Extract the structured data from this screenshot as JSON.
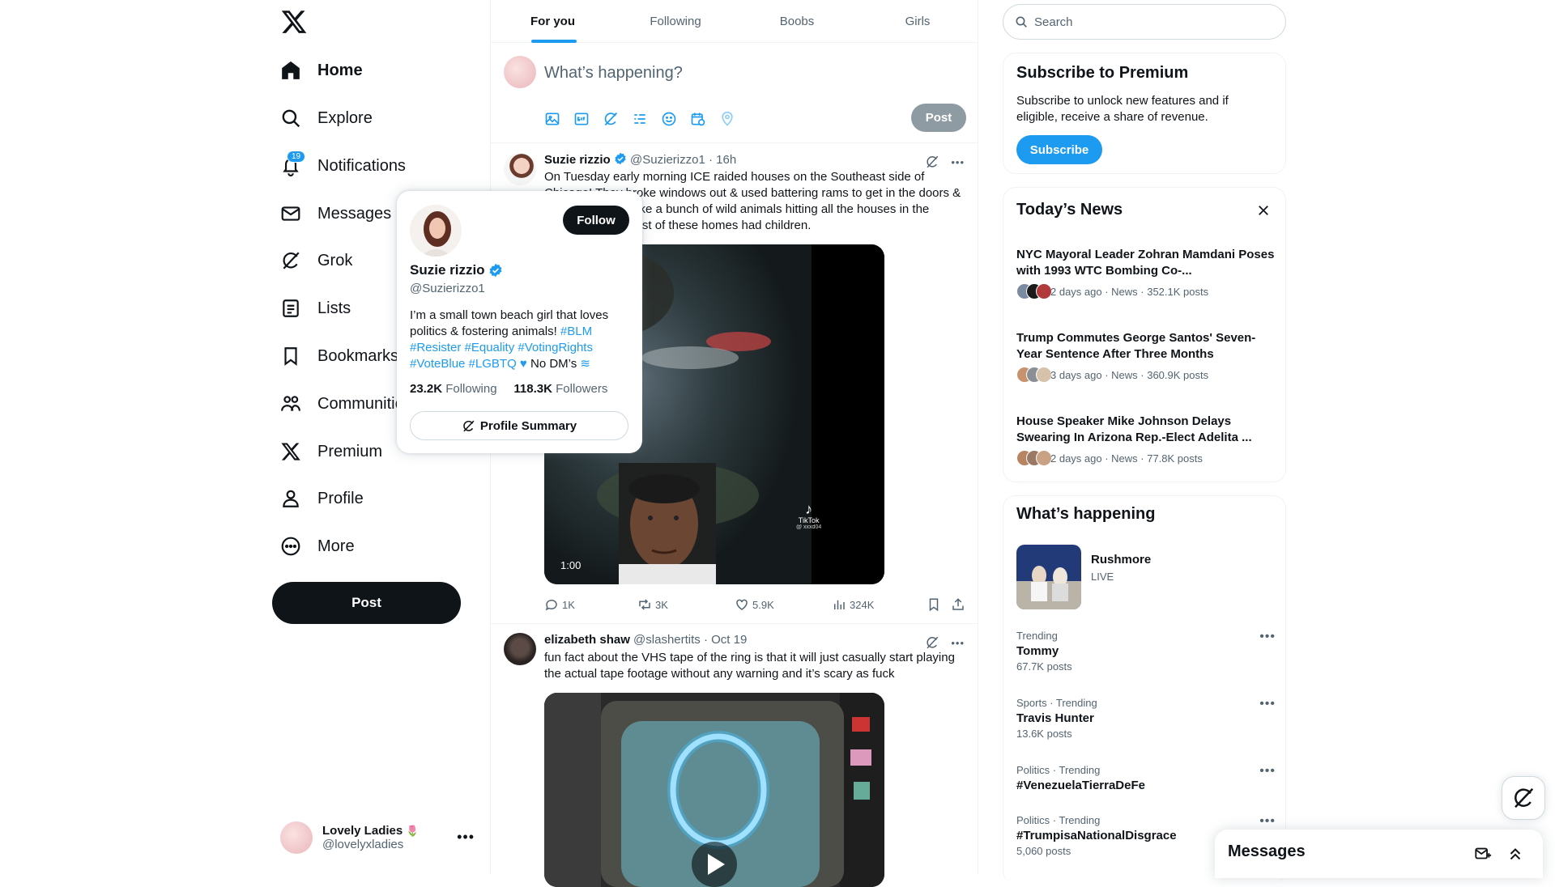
{
  "nav": {
    "items": [
      {
        "label": "Home",
        "icon": "home-icon"
      },
      {
        "label": "Explore",
        "icon": "search-icon"
      },
      {
        "label": "Notifications",
        "icon": "bell-icon",
        "badge": "19"
      },
      {
        "label": "Messages",
        "icon": "mail-icon"
      },
      {
        "label": "Grok",
        "icon": "grok-icon"
      },
      {
        "label": "Lists",
        "icon": "lists-icon"
      },
      {
        "label": "Bookmarks",
        "icon": "bookmark-icon"
      },
      {
        "label": "Communities",
        "icon": "communities-icon"
      },
      {
        "label": "Premium",
        "icon": "x-icon"
      },
      {
        "label": "Profile",
        "icon": "profile-icon"
      },
      {
        "label": "More",
        "icon": "more-circle-icon"
      }
    ],
    "post_label": "Post"
  },
  "account": {
    "name": "Lovely Ladies",
    "handle": "@lovelyxladies",
    "badge_glyph": "🌷"
  },
  "tabs": [
    "For you",
    "Following",
    "Boobs",
    "Girls"
  ],
  "composer": {
    "placeholder": "What’s happening?",
    "post_label": "Post"
  },
  "tweets": [
    {
      "name": "Suzie rizzio",
      "handle": "@Suzierizzo1",
      "time": "16h",
      "text": "On Tuesday early morning ICE raided houses on the Southeast side of Chicago! They broke windows out & used battering rams to get in the doors & it literally looked like a bunch of wild animals hitting all the houses in the neighborhood! Most of these homes had children.",
      "video_duration": "1:00",
      "watermark": "TikTok",
      "watermark_user": "@ xxxd04",
      "replies": "1K",
      "reposts": "3K",
      "likes": "5.9K",
      "views": "324K"
    },
    {
      "name": "elizabeth shaw",
      "handle": "@slashertits",
      "time": "Oct 19",
      "text": "fun fact about the VHS tape of the ring is that it will just casually start playing the actual tape footage without any warning and it’s scary as fuck"
    }
  ],
  "hovercard": {
    "name": "Suzie rizzio",
    "handle": "@Suzierizzo1",
    "follow_label": "Follow",
    "bio_line1": "I’m a small town beach girl that loves politics & fostering animals!",
    "bio_tag1": "#BLM",
    "bio_tags2": "#Resister #Equality #VotingRights",
    "bio_tags3": "#VoteBlue #LGBTQ",
    "bio_tail": "No DM’s",
    "following_count": "23.2K",
    "following_label": "Following",
    "followers_count": "118.3K",
    "followers_label": "Followers",
    "summary_label": "Profile Summary"
  },
  "right": {
    "search_placeholder": "Search",
    "premium": {
      "title": "Subscribe to Premium",
      "desc": "Subscribe to unlock new features and if eligible, receive a share of revenue.",
      "button": "Subscribe"
    },
    "news": {
      "title": "Today’s News",
      "items": [
        {
          "headline": "NYC Mayoral Leader Zohran Mamdani Poses with 1993 WTC Bombing Co-...",
          "meta": "2 days ago · News · 352.1K posts"
        },
        {
          "headline": "Trump Commutes George Santos' Seven-Year Sentence After Three Months",
          "meta": "3 days ago · News · 360.9K posts"
        },
        {
          "headline": "House Speaker Mike Johnson Delays Swearing In Arizona Rep.-Elect Adelita ...",
          "meta": "2 days ago · News · 77.8K posts"
        }
      ]
    },
    "happening": {
      "title": "What’s happening",
      "live_title": "Rushmore",
      "live_label": "LIVE",
      "trends": [
        {
          "context": "Trending",
          "title": "Tommy",
          "posts": "67.7K posts"
        },
        {
          "context": "Sports · Trending",
          "title": "Travis Hunter",
          "posts": "13.6K posts"
        },
        {
          "context": "Politics · Trending",
          "title": "#VenezuelaTierraDeFe",
          "posts": ""
        },
        {
          "context": "Politics · Trending",
          "title": "#TrumpisaNationalDisgrace",
          "posts": "5,060 posts"
        }
      ]
    }
  },
  "messages_drawer": {
    "title": "Messages"
  },
  "colors": {
    "accent": "#1d9bf0",
    "text": "#0f1419",
    "muted": "#536471",
    "border": "#eff3f4"
  }
}
